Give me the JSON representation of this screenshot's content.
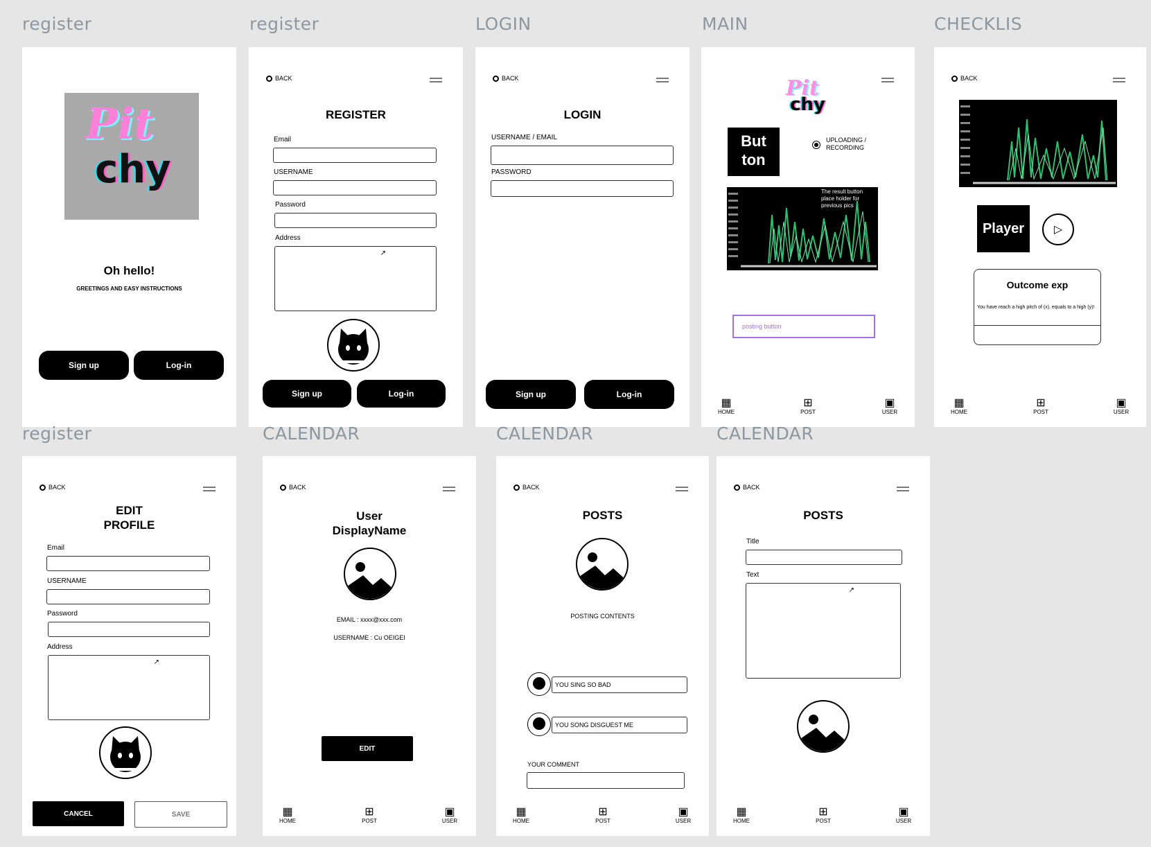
{
  "labels": {
    "f1": "register",
    "f2": "register",
    "f3": "LOGIN",
    "f4": "MAIN",
    "f5": "CHECKLIS",
    "f6": "register",
    "f7": "CALENDAR",
    "f8": "CALENDAR",
    "f9": "CALENDAR"
  },
  "common": {
    "back": "BACK",
    "nav_home": "HOME",
    "nav_post": "POST",
    "nav_user": "USER"
  },
  "welcome": {
    "logo_line1": "Pit",
    "logo_line2": "chy",
    "greeting": "Oh hello!",
    "subtitle": "GREETINGS AND EASY INSTRUCTIONS",
    "signup": "Sign up",
    "login": "Log-in"
  },
  "register": {
    "title": "REGISTER",
    "email": "Email",
    "username": "USERNAME",
    "password": "Password",
    "address": "Address",
    "signup": "Sign up",
    "login": "Log-in"
  },
  "login": {
    "title": "LOGIN",
    "username": "USERNAME / EMAIL",
    "password": "PASSWORD",
    "signup": "Sign up",
    "login": "Log-in"
  },
  "main": {
    "logo_line1": "Pit",
    "logo_line2": "chy",
    "button_line1": "But",
    "button_line2": "ton",
    "radio_label": "UPLOADING / RECORDING",
    "overlay_text": "The result button place holder for previous pics",
    "posting_placeholder": "posting button"
  },
  "checklist": {
    "player": "Player",
    "outcome_title": "Outcome exp",
    "outcome_text": "You have reach a high pitch of (x), equals to a high (y)!"
  },
  "edit_profile": {
    "title_line1": "EDIT",
    "title_line2": "PROFILE",
    "email": "Email",
    "username": "USERNAME",
    "password": "Password",
    "address": "Address",
    "cancel": "CANCEL",
    "save": "SAVE"
  },
  "user": {
    "title_line1": "User",
    "title_line2": "DisplayName",
    "email": "EMAIL : xxxx@xxx.com",
    "username": "USERNAME : Cu OEIGEI",
    "edit": "EDIT"
  },
  "posts": {
    "title": "POSTS",
    "contents": "POSTING CONTENTS",
    "comment1": "YOU SING SO BAD",
    "comment2": "YOU SONG DISGUEST ME",
    "your_comment": "YOUR COMMENT"
  },
  "posts_new": {
    "title": "POSTS",
    "title_label": "Title",
    "text_label": "Text"
  },
  "colors": {
    "background": "#e6e6e6",
    "label": "#8d97a0",
    "accent_purple": "#a86ee8",
    "chart_green": "#2fbf71"
  }
}
